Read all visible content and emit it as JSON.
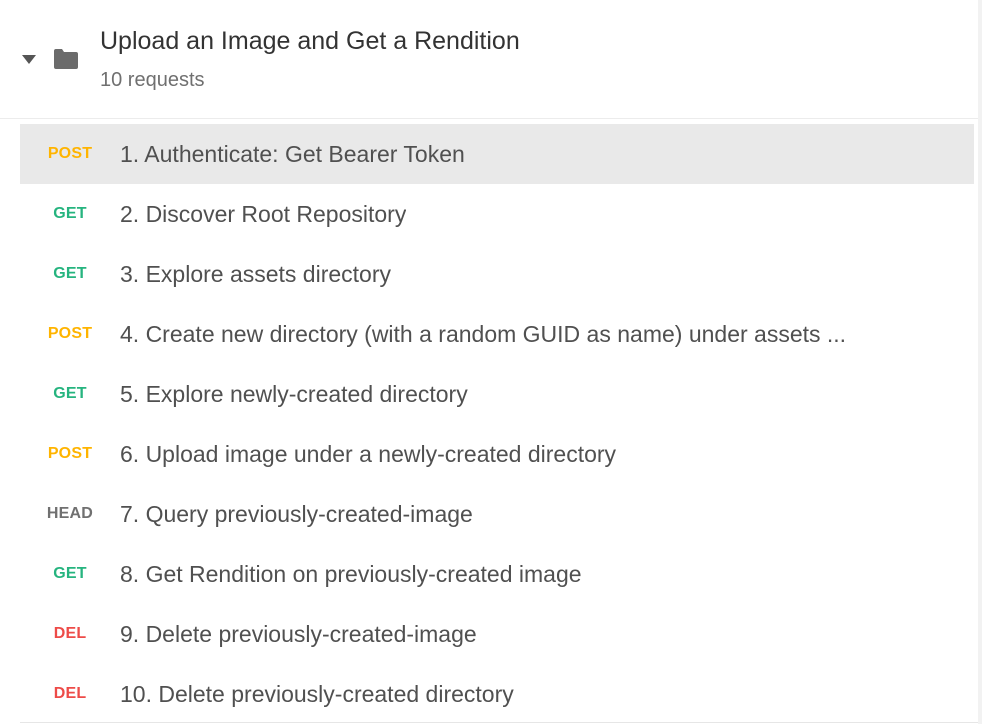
{
  "collection": {
    "title": "Upload an Image and Get a Rendition",
    "subtitle": "10 requests",
    "expanded": true,
    "caret_icon": "caret-down-icon",
    "folder_icon": "folder-icon"
  },
  "colors": {
    "POST": "#ffb400",
    "GET": "#26b47f",
    "HEAD": "#707070",
    "DEL": "#ed4b48",
    "selected_row_bg": "#e9e9e9"
  },
  "requests": [
    {
      "method": "POST",
      "name": "1. Authenticate: Get Bearer Token",
      "selected": true
    },
    {
      "method": "GET",
      "name": "2. Discover Root Repository",
      "selected": false
    },
    {
      "method": "GET",
      "name": "3. Explore assets directory",
      "selected": false
    },
    {
      "method": "POST",
      "name": "4. Create new directory (with a random GUID as name) under assets ...",
      "selected": false
    },
    {
      "method": "GET",
      "name": "5. Explore newly-created directory",
      "selected": false
    },
    {
      "method": "POST",
      "name": "6. Upload image under a newly-created directory",
      "selected": false
    },
    {
      "method": "HEAD",
      "name": "7. Query previously-created-image",
      "selected": false
    },
    {
      "method": "GET",
      "name": "8. Get Rendition on previously-created image",
      "selected": false
    },
    {
      "method": "DEL",
      "name": "9. Delete previously-created-image",
      "selected": false
    },
    {
      "method": "DEL",
      "name": "10. Delete previously-created directory",
      "selected": false
    }
  ]
}
